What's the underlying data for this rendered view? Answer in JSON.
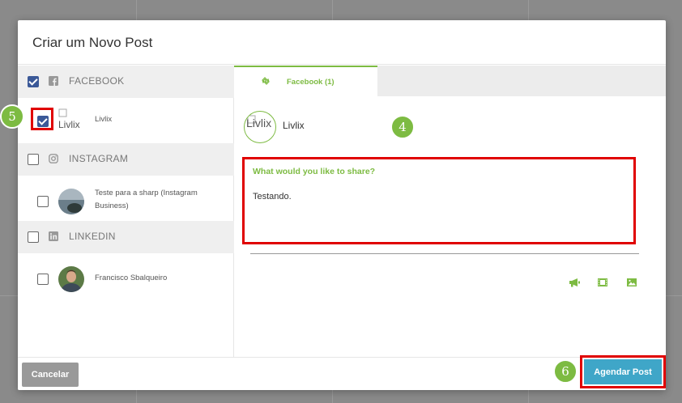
{
  "modal": {
    "title": "Criar um Novo Post"
  },
  "networks": [
    {
      "label": "FACEBOOK",
      "checked": true,
      "accounts": [
        {
          "name": "Livlix",
          "avatar_alt": "Livlix",
          "checked": true
        }
      ]
    },
    {
      "label": "INSTAGRAM",
      "checked": false,
      "accounts": [
        {
          "name_line1": "Teste para a sharp (Instagram",
          "name_line2": "Business)",
          "checked": false
        }
      ]
    },
    {
      "label": "LINKEDIN",
      "checked": false,
      "accounts": [
        {
          "name": "Francisco Sbalqueiro",
          "checked": false
        }
      ]
    }
  ],
  "editor": {
    "tab_label": "Facebook (1)",
    "profile_alt": "Livlix",
    "profile_name": "Livlix",
    "compose_label": "What would you like to share?",
    "compose_text": "Testando."
  },
  "footer": {
    "cancel_label": "Cancelar",
    "schedule_label": "Agendar Post"
  },
  "steps": {
    "four": "4",
    "five": "5",
    "six": "6"
  },
  "colors": {
    "accent_green": "#7dbb42",
    "facebook_blue": "#3b5998",
    "schedule_blue": "#3fa6c8",
    "highlight_red": "#e00000"
  }
}
